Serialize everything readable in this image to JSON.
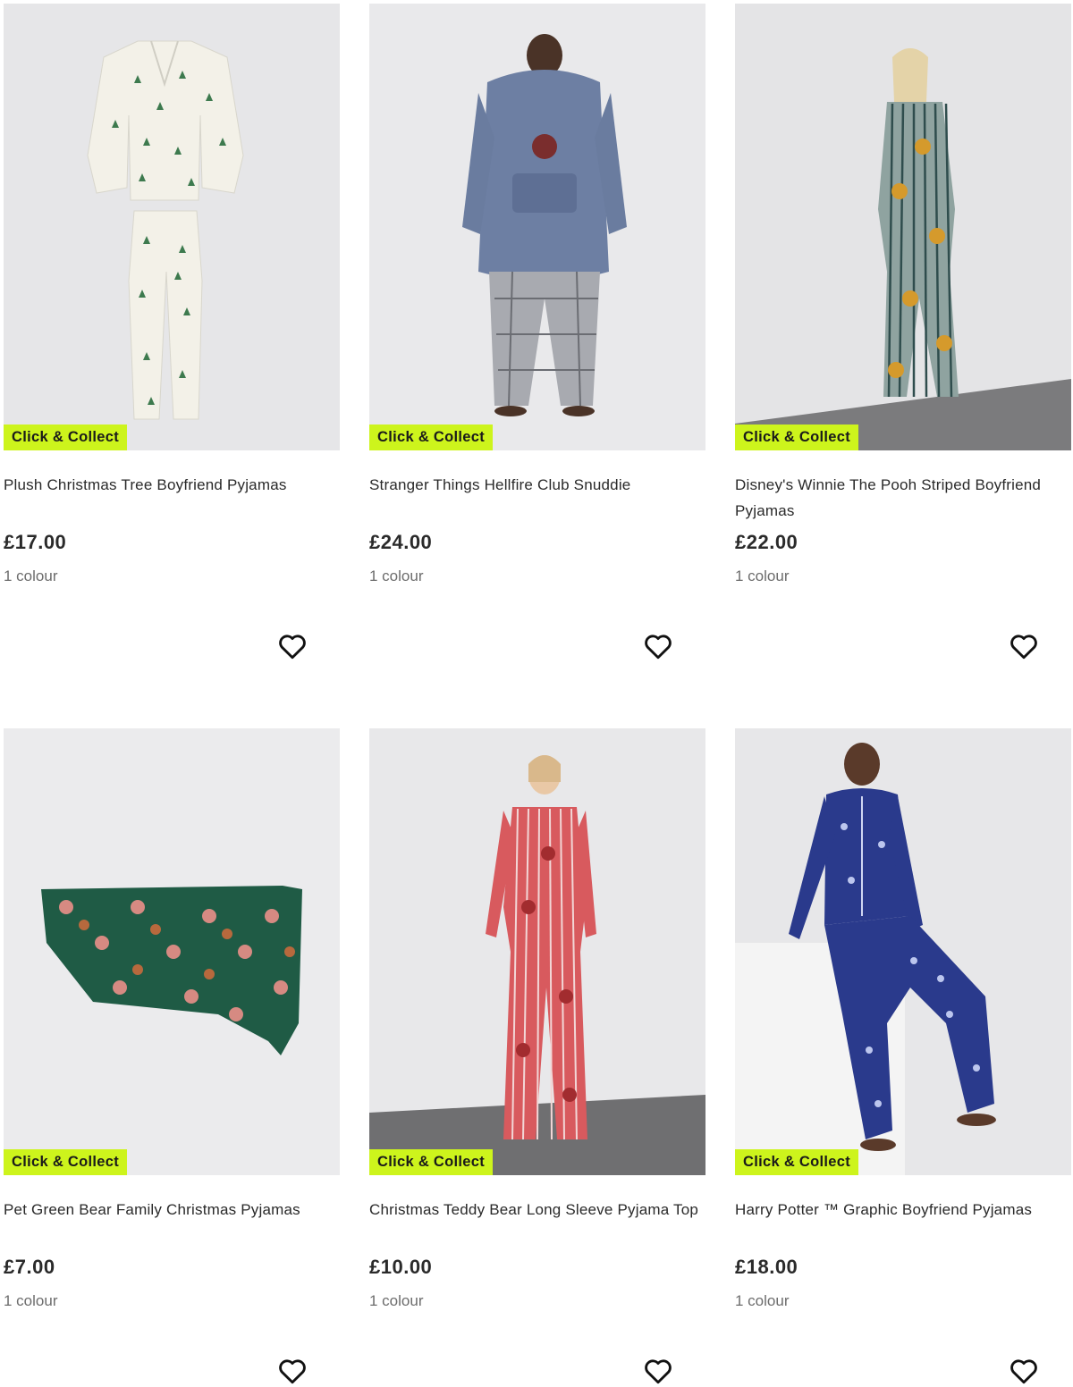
{
  "badge_label": "Click & Collect",
  "colors": {
    "badge_bg": "#cdf41c"
  },
  "products": [
    {
      "title": "Plush Christmas Tree Boyfriend Pyjamas",
      "price": "£17.00",
      "colours": "1 colour",
      "icon": "heart-outline-icon"
    },
    {
      "title": "Stranger Things Hellfire Club Snuddie",
      "price": "£24.00",
      "colours": "1 colour",
      "icon": "heart-outline-icon"
    },
    {
      "title": "Disney's Winnie The Pooh Striped Boyfriend Pyjamas",
      "price": "£22.00",
      "colours": "1 colour",
      "icon": "heart-outline-icon"
    },
    {
      "title": "Pet Green Bear Family Christmas Pyjamas",
      "price": "£7.00",
      "colours": "1 colour",
      "icon": "heart-outline-icon"
    },
    {
      "title": "Christmas Teddy Bear Long Sleeve Pyjama Top",
      "price": "£10.00",
      "colours": "1 colour",
      "icon": "heart-outline-icon"
    },
    {
      "title": "Harry Potter ™ Graphic Boyfriend Pyjamas",
      "price": "£18.00",
      "colours": "1 colour",
      "icon": "heart-outline-icon"
    }
  ]
}
